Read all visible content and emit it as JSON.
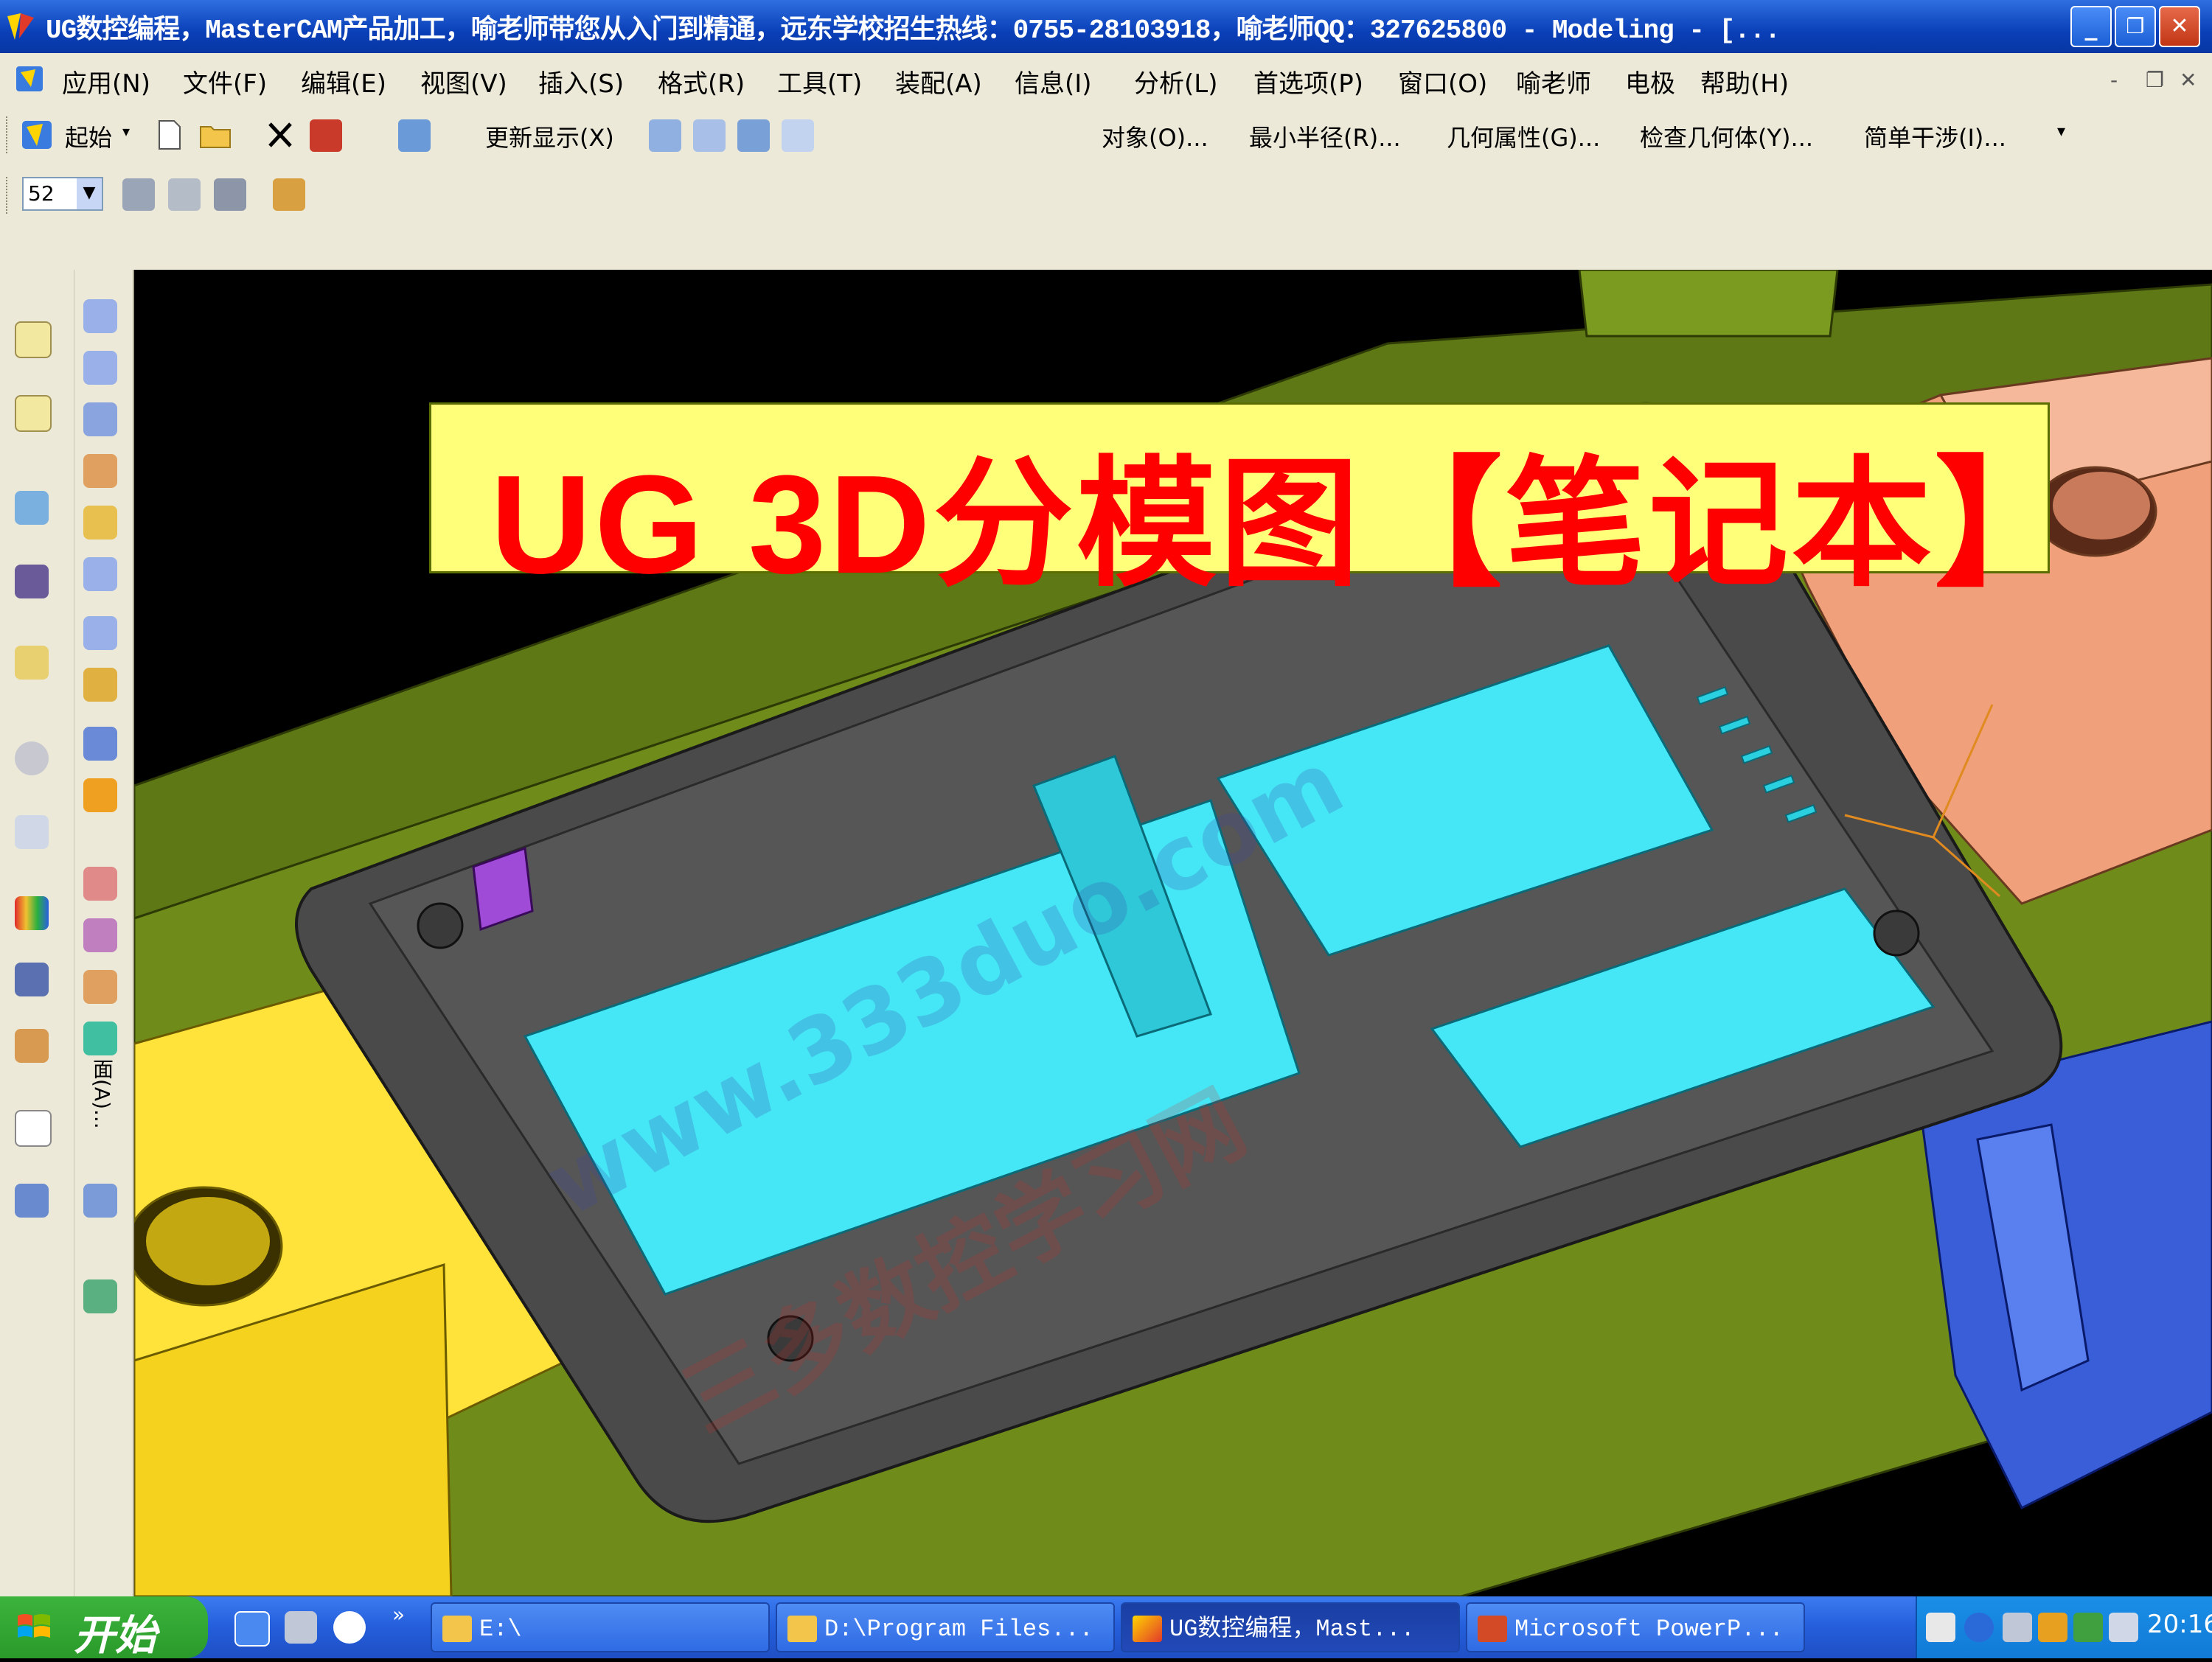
{
  "window": {
    "title": "UG数控编程，MasterCAM产品加工，喻老师带您从入门到精通，远东学校招生热线：0755-28103918，喻老师QQ：327625800 - Modeling - [...",
    "minimize": "_",
    "restore": "❐",
    "close": "✕"
  },
  "menu": {
    "items": [
      "应用(N)",
      "文件(F)",
      "编辑(E)",
      "视图(V)",
      "插入(S)",
      "格式(R)",
      "工具(T)",
      "装配(A)",
      "信息(I)",
      "分析(L)",
      "首选项(P)",
      "窗口(O)",
      "喻老师",
      "电极",
      "帮助(H)"
    ],
    "mdi_min": "-",
    "mdi_restore": "❐",
    "mdi_close": "✕"
  },
  "toolbar": {
    "start_label": "起始",
    "refresh_label": "更新显示(X)",
    "object_label": "对象(O)...",
    "min_radius_label": "最小半径(R)...",
    "geom_props_label": "几何属性(G)...",
    "check_geom_label": "检查几何体(Y)...",
    "interference_label": "简单干涉(I)...",
    "layer_value": "52"
  },
  "leftbar": {
    "vertical_text": "面(A)..."
  },
  "banner": {
    "text": "UG 3D分模图【笔记本】"
  },
  "watermark": {
    "url": "www.333duo.com",
    "name": "三多数控学习网"
  },
  "taskbar": {
    "start": "开始",
    "tasks": [
      "E:\\",
      "D:\\Program Files...",
      "UG数控编程，Mast...",
      "Microsoft PowerP..."
    ],
    "clock": "20:16"
  },
  "colors": {
    "title_blue": "#0a3fb8",
    "chrome": "#ece9d8",
    "banner_bg": "#ffff7a",
    "banner_text": "#ff0000",
    "mold_green": "#6f8c1b",
    "part_gray": "#4a4a4a",
    "insert_cyan": "#45e6f5",
    "slide_yellow": "#ffe23a",
    "slide_salmon": "#f0a07a",
    "slide_blue": "#3a5ed8",
    "lifter_purple": "#a04ad8"
  }
}
